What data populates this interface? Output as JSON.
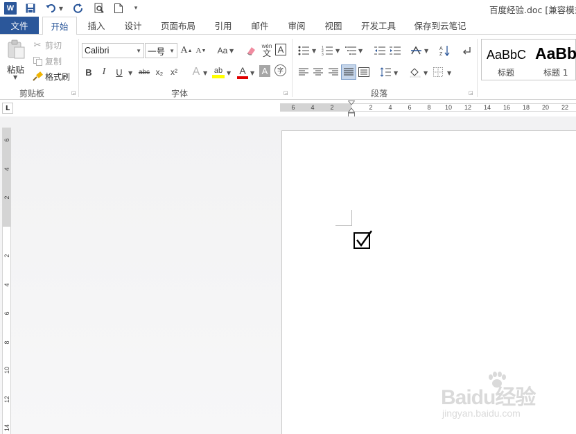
{
  "title_bar": {
    "app_icon": "word-icon",
    "app_letter": "W",
    "quick_access": [
      "save-icon",
      "undo-icon",
      "redo-icon",
      "print-preview-icon",
      "new-document-icon",
      "customize-toolbar-icon"
    ],
    "document_title": "百度经验.doc [兼容模式"
  },
  "tabs": {
    "file": "文件",
    "items": [
      "开始",
      "插入",
      "设计",
      "页面布局",
      "引用",
      "邮件",
      "审阅",
      "视图",
      "开发工具",
      "保存到云笔记"
    ],
    "active": "开始"
  },
  "ribbon": {
    "clipboard": {
      "paste": "粘贴",
      "cut": "剪切",
      "copy": "复制",
      "format_painter": "格式刷",
      "group_label": "剪贴板"
    },
    "font": {
      "font_name": "Calibri",
      "font_size": "一号",
      "change_case": "Aa",
      "phonetic_guide": "wén",
      "phonetic_char": "文",
      "char_border": "A",
      "bold": "B",
      "italic": "I",
      "underline": "U",
      "strikethrough": "abc",
      "subscript": "x₂",
      "superscript": "x²",
      "text_effects": "A",
      "highlight": "ab",
      "font_color": "A",
      "char_shading": "A",
      "enclose": "字",
      "group_label": "字体"
    },
    "paragraph": {
      "group_label": "段落"
    },
    "styles": {
      "items": [
        {
          "sample": "AaBbC",
          "name": "标题"
        },
        {
          "sample": "AaBb",
          "name": "标题 1"
        }
      ]
    }
  },
  "ruler": {
    "tab_selector": "L",
    "horizontal_numbers": [
      "6",
      "4",
      "2",
      "2",
      "4",
      "6",
      "8",
      "10",
      "12",
      "14",
      "16",
      "18",
      "20",
      "22"
    ],
    "vertical_numbers": [
      "6",
      "4",
      "2",
      "2",
      "4",
      "6",
      "8",
      "10",
      "12",
      "14"
    ]
  },
  "document": {
    "content_char": "☑"
  },
  "watermark": {
    "brand": "Baidu经验",
    "url": "jingyan.baidu.com"
  },
  "colors": {
    "accent": "#2b579a",
    "highlight_yellow": "#ffff00",
    "font_color_red": "#e00000",
    "selected_button": "#c5d5ea"
  }
}
